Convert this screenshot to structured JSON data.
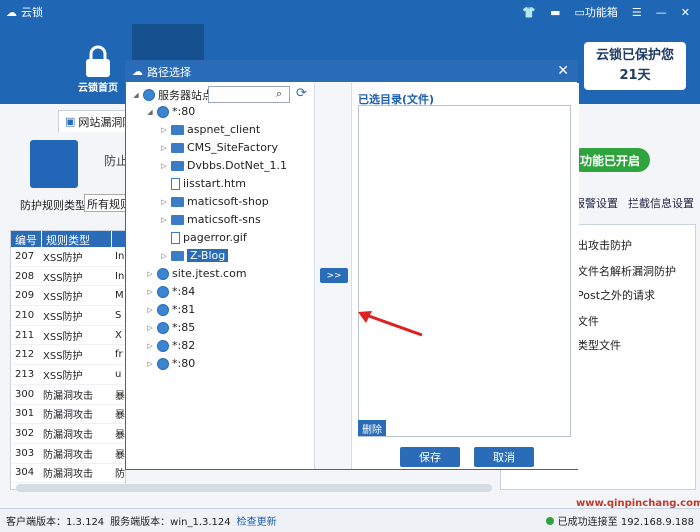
{
  "titlebar": {
    "app_name": "云锁",
    "feature_box": "功能箱",
    "min": "—",
    "max": "☰",
    "close": "✕"
  },
  "nav": {
    "home_label": "云锁首页"
  },
  "protect_badge": {
    "line1": "云锁已保护您",
    "line2": "21天"
  },
  "main": {
    "tab_label": "网站漏洞防",
    "prevent_text": "防止",
    "rule_type_label": "防护规则类型",
    "rule_type_value": "所有规则",
    "status_pill": "功能已开启",
    "links": [
      "报警设置",
      "拦截信息设置"
    ],
    "right_items": [
      "出攻击防护",
      "文件名解析漏洞防护",
      "Post之外的请求",
      "文件",
      "类型文件"
    ]
  },
  "rules": {
    "headers": [
      "编号",
      "规则类型"
    ],
    "rows": [
      {
        "id": "207",
        "type": "XSS防护",
        "extra": "In"
      },
      {
        "id": "208",
        "type": "XSS防护",
        "extra": "In"
      },
      {
        "id": "209",
        "type": "XSS防护",
        "extra": "M"
      },
      {
        "id": "210",
        "type": "XSS防护",
        "extra": "S"
      },
      {
        "id": "211",
        "type": "XSS防护",
        "extra": "X"
      },
      {
        "id": "212",
        "type": "XSS防护",
        "extra": "fr"
      },
      {
        "id": "213",
        "type": "XSS防护",
        "extra": "u"
      },
      {
        "id": "300",
        "type": "防漏洞攻击",
        "extra": "暴"
      },
      {
        "id": "301",
        "type": "防漏洞攻击",
        "extra": "暴"
      },
      {
        "id": "302",
        "type": "防漏洞攻击",
        "extra": "暴"
      },
      {
        "id": "303",
        "type": "防漏洞攻击",
        "extra": "暴"
      },
      {
        "id": "304",
        "type": "防漏洞攻击",
        "extra": "防"
      }
    ]
  },
  "footer": {
    "client_version": "客户端版本：1.3.124",
    "server_version": "服务端版本：win_1.3.124",
    "check_update": "检查更新",
    "connection": "已成功连接至 192.168.9.188",
    "watermark": "www.qinpinchang.com"
  },
  "dialog": {
    "title": "路径选择",
    "close": "✕",
    "root": "服务器站点",
    "selected_label": "已选目录(文件)",
    "add_button": ">>",
    "delete_button": "删除",
    "save_button": "保存",
    "cancel_button": "取消",
    "tree": {
      "port80": "*:80",
      "children": [
        "aspnet_client",
        "CMS_SiteFactory",
        "Dvbbs.DotNet_1.1",
        "iisstart.htm",
        "maticsoft-shop",
        "maticsoft-sns",
        "pagerror.gif",
        "Z-Blog"
      ],
      "sites": [
        "site.jtest.com",
        "*:84",
        "*:81",
        "*:85",
        "*:82",
        "*:80"
      ]
    }
  }
}
